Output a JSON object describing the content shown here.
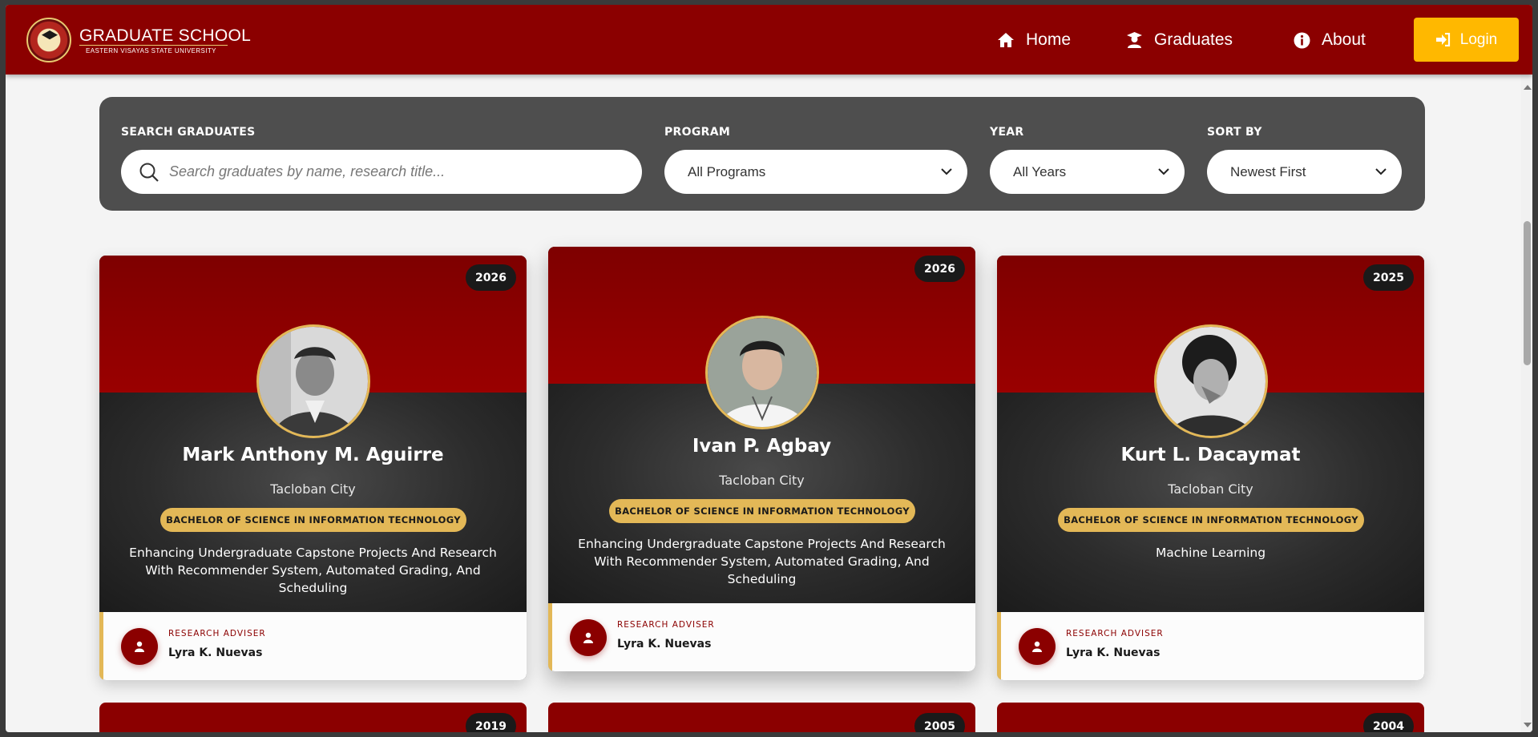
{
  "brand": {
    "title": "GRADUATE SCHOOL",
    "subtitle": "EASTERN VISAYAS STATE UNIVERSITY"
  },
  "nav": {
    "home": "Home",
    "graduates": "Graduates",
    "about": "About",
    "login": "Login"
  },
  "filters": {
    "search_label": "SEARCH GRADUATES",
    "search_placeholder": "Search graduates by name, research title...",
    "program_label": "PROGRAM",
    "program_value": "All Programs",
    "year_label": "YEAR",
    "year_value": "All Years",
    "sort_label": "SORT BY",
    "sort_value": "Newest First"
  },
  "cards": [
    {
      "year": "2026",
      "name": "Mark Anthony M. Aguirre",
      "city": "Tacloban City",
      "program": "BACHELOR OF SCIENCE IN INFORMATION TECHNOLOGY",
      "research": "Enhancing Undergraduate Capstone Projects And Research With Recommender System, Automated Grading, And Scheduling",
      "adviser_label": "RESEARCH ADVISER",
      "adviser": "Lyra K. Nuevas"
    },
    {
      "year": "2026",
      "name": "Ivan P. Agbay",
      "city": "Tacloban City",
      "program": "BACHELOR OF SCIENCE IN INFORMATION TECHNOLOGY",
      "research": "Enhancing Undergraduate Capstone Projects And Research With Recommender System, Automated Grading, And Scheduling",
      "adviser_label": "RESEARCH ADVISER",
      "adviser": "Lyra K. Nuevas"
    },
    {
      "year": "2025",
      "name": "Kurt L. Dacaymat",
      "city": "Tacloban City",
      "program": "BACHELOR OF SCIENCE IN INFORMATION TECHNOLOGY",
      "research": "Machine Learning",
      "adviser_label": "RESEARCH ADVISER",
      "adviser": "Lyra K. Nuevas"
    }
  ],
  "next_cards": [
    {
      "year": "2019"
    },
    {
      "year": "2005"
    },
    {
      "year": "2004"
    }
  ],
  "colors": {
    "brand_red": "#8b0000",
    "accent_gold": "#e3b857",
    "login_yellow": "#ffb800",
    "filter_bg": "#4e4e4e"
  },
  "icons": [
    "home-icon",
    "graduate-icon",
    "info-icon",
    "login-icon",
    "search-icon",
    "chevron-down-icon",
    "user-icon"
  ]
}
